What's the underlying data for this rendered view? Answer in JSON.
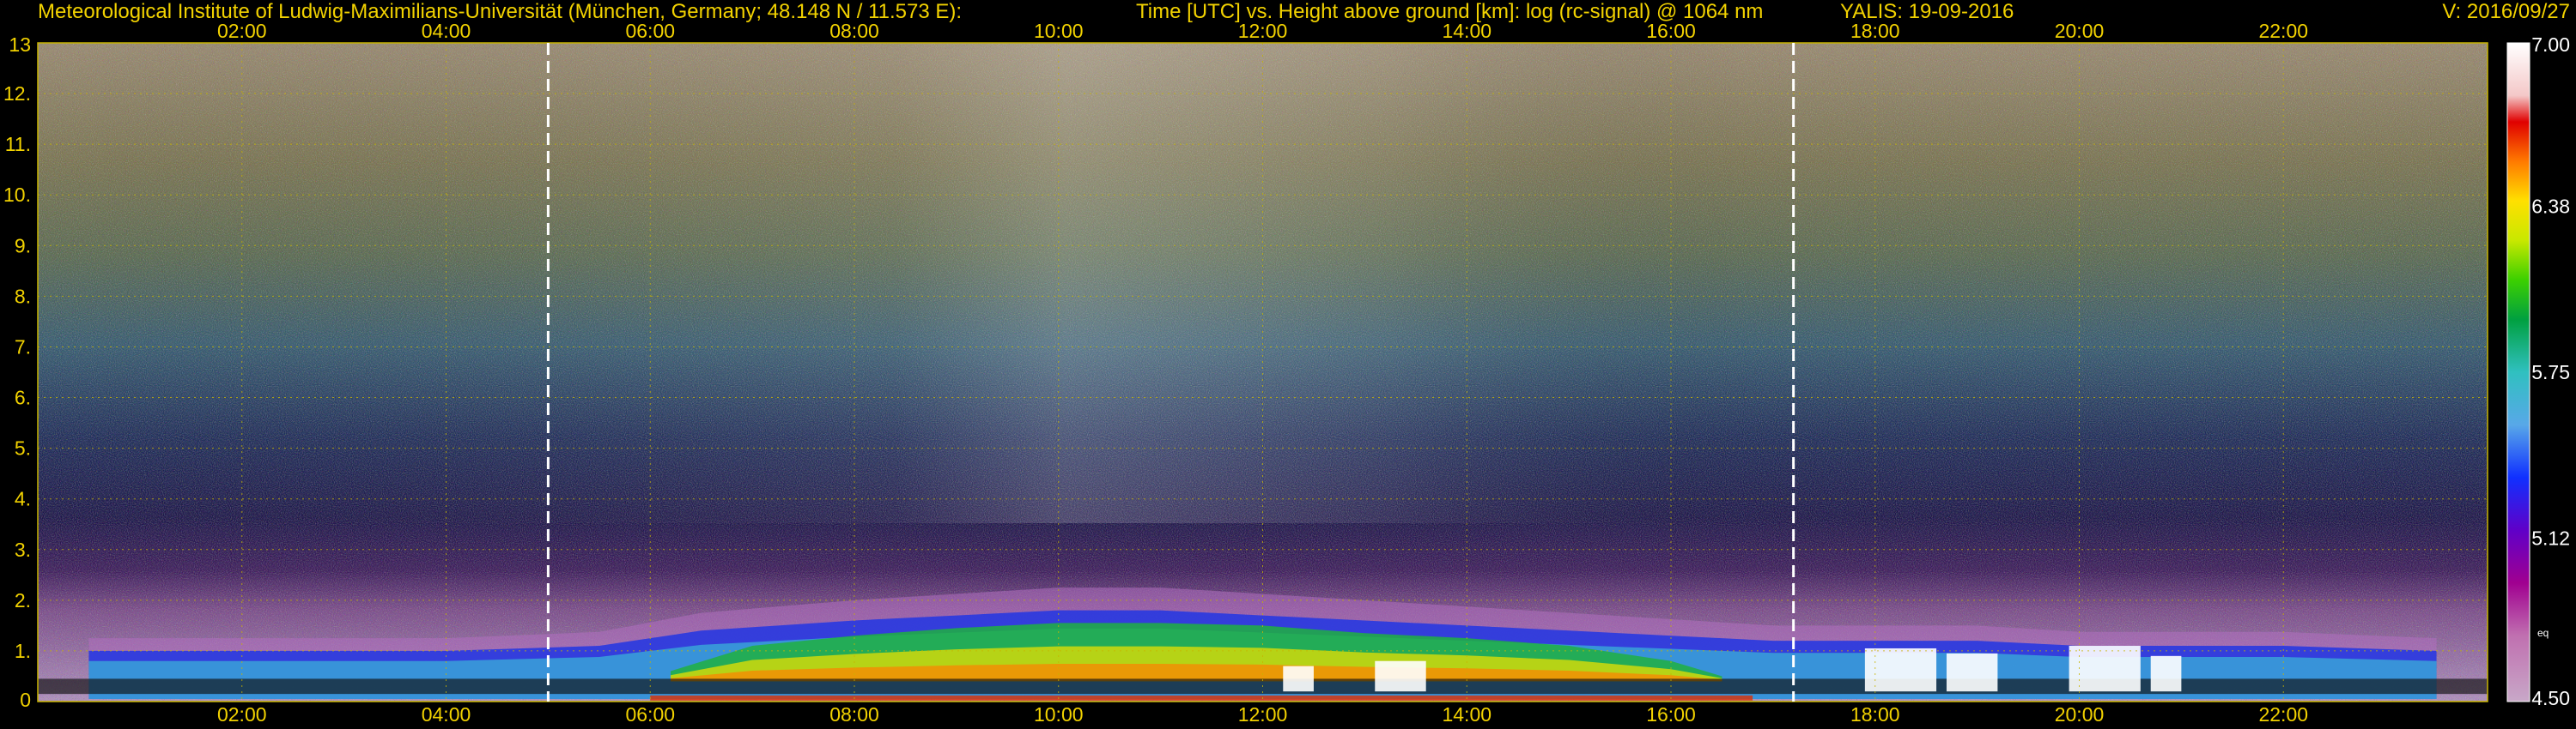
{
  "header": {
    "institute": "Meteorological Institute of Ludwig-Maximilians-Universität (München, Germany; 48.148 N / 11.573 E):",
    "description": "Time [UTC] vs. Height above ground [km]: log (rc-signal) @ 1064 nm",
    "instrument_date": "YALIS: 19-09-2016",
    "version": "V: 2016/09/27"
  },
  "colors": {
    "label_text": "#f2d200",
    "grid": "#c8b400",
    "background": "#000000",
    "marker_line": "#ffffff"
  },
  "chart_data": {
    "type": "heatmap",
    "title": "Time [UTC] vs. Height above ground [km]: log (rc-signal) @ 1064 nm",
    "xlabel": "",
    "ylabel": "",
    "xlim": [
      0,
      24
    ],
    "ylim": [
      0,
      13
    ],
    "x_ticks": [
      "02:00",
      "04:00",
      "06:00",
      "08:00",
      "10:00",
      "12:00",
      "14:00",
      "16:00",
      "18:00",
      "20:00",
      "22:00"
    ],
    "x_tick_values": [
      2,
      4,
      6,
      8,
      10,
      12,
      14,
      16,
      18,
      20,
      22
    ],
    "y_ticks": [
      "0",
      "1.",
      "2.",
      "3.",
      "4.",
      "5.",
      "6.",
      "7.",
      "8.",
      "9.",
      "10.",
      "11.",
      "12.",
      "13"
    ],
    "y_tick_values": [
      0,
      1,
      2,
      3,
      4,
      5,
      6,
      7,
      8,
      9,
      10,
      11,
      12,
      13
    ],
    "marker_lines_utc": [
      5.0,
      17.2
    ],
    "grid": true,
    "colorbar": {
      "range": [
        4.5,
        7.0
      ],
      "tick_labels": [
        "7.00",
        "6.38",
        "5.75",
        "5.12",
        "4.50"
      ],
      "tick_values": [
        7.0,
        6.38,
        5.75,
        5.12,
        4.5
      ],
      "small_label": "eq",
      "placement": "right"
    },
    "boundary_layer": {
      "time_utc": [
        0.5,
        2,
        4,
        5.5,
        6.5,
        8,
        9,
        10,
        11,
        12,
        13,
        14,
        15,
        16,
        17,
        18,
        19,
        20,
        21,
        22,
        23.5
      ],
      "aerosol_top_km": [
        1.0,
        1.0,
        1.0,
        1.1,
        1.4,
        1.6,
        1.7,
        1.8,
        1.8,
        1.7,
        1.6,
        1.5,
        1.4,
        1.3,
        1.2,
        1.2,
        1.2,
        1.1,
        1.1,
        1.1,
        1.0
      ]
    }
  }
}
